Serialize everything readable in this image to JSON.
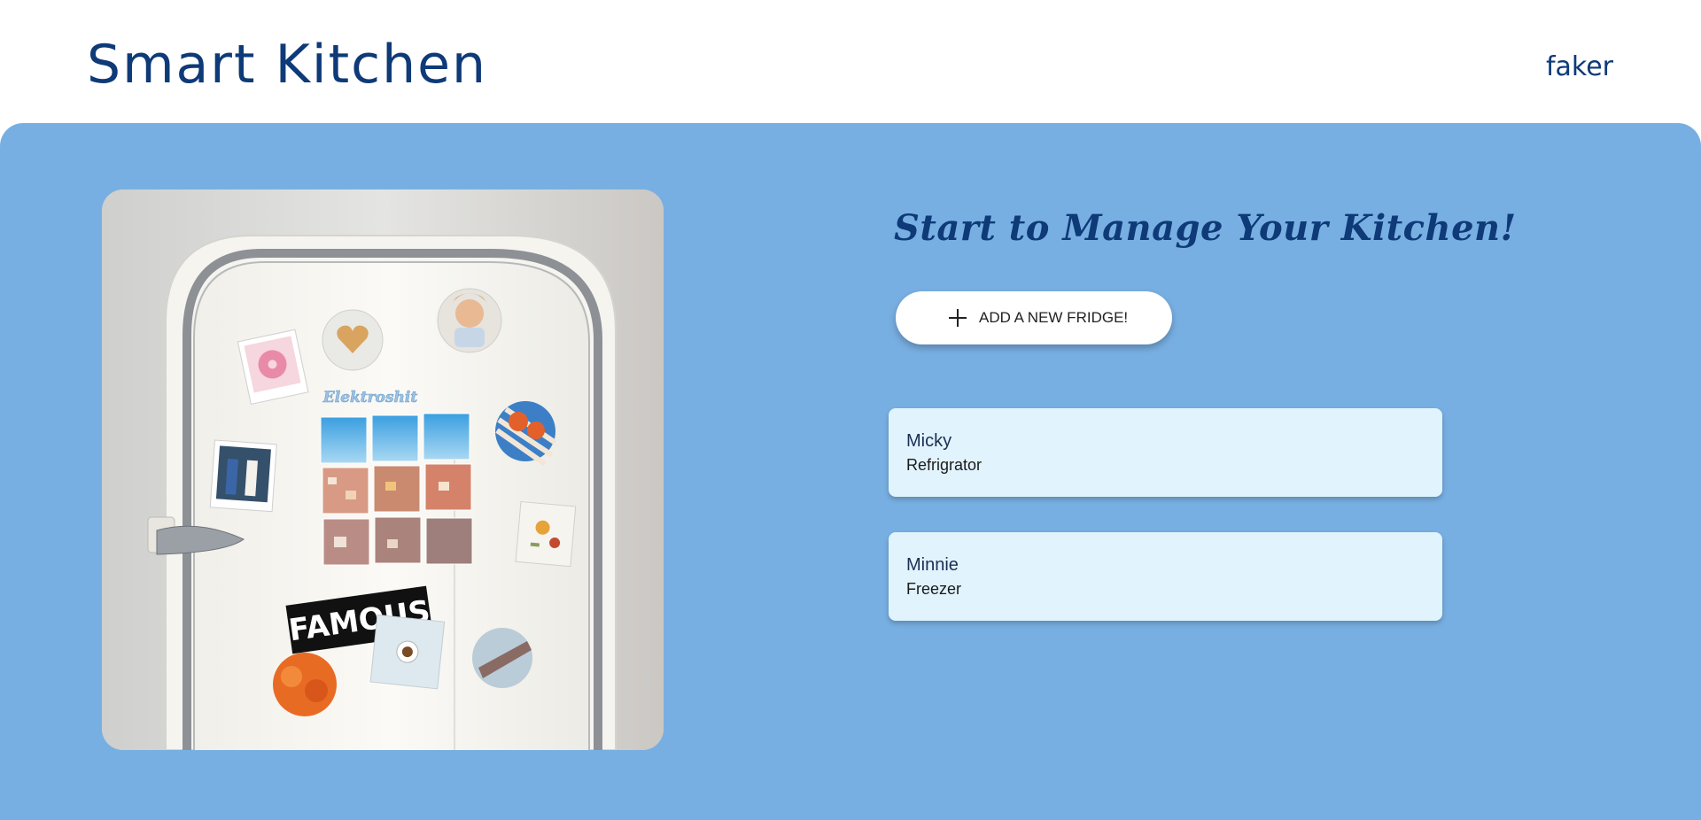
{
  "header": {
    "app_title": "Smart Kitchen",
    "user_name": "faker"
  },
  "main": {
    "headline": "Start to Manage Your Kitchen!",
    "add_button_label": "ADD A NEW FRIDGE!",
    "image_text": {
      "brand_sticker": "Elektroshit",
      "famous_sticker": "FAMOUS"
    },
    "fridges": [
      {
        "name": "Micky",
        "type": "Refrigrator"
      },
      {
        "name": "Minnie",
        "type": "Freezer"
      }
    ]
  },
  "colors": {
    "primary_text": "#0e3a78",
    "main_background": "#78afe2",
    "card_background": "#e1f3fc",
    "button_background": "#ffffff"
  },
  "icons": {
    "add_button_icon": "plus-icon",
    "hero_image": "fridge-with-magnets-photo"
  }
}
